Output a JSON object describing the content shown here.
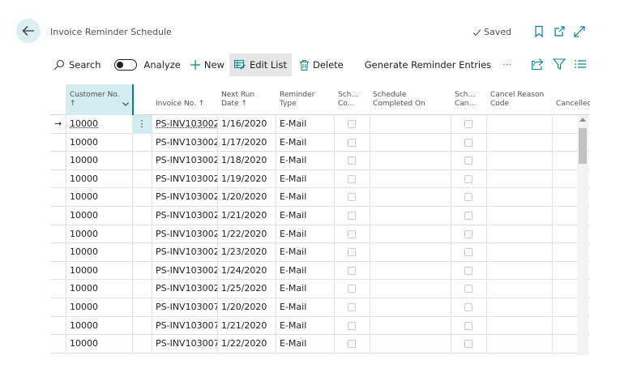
{
  "header": {
    "title": "Invoice Reminder Schedule",
    "saved_label": "Saved"
  },
  "toolbar": {
    "search": "Search",
    "analyze": "Analyze",
    "new": "New",
    "edit_list": "Edit List",
    "delete": "Delete",
    "generate": "Generate Reminder Entries",
    "more": "···"
  },
  "columns": [
    {
      "line1": "Customer No.",
      "line2": "↑"
    },
    {
      "line1": "",
      "line2": "Invoice No. ↑"
    },
    {
      "line1": "Next Run",
      "line2": "Date ↑"
    },
    {
      "line1": "Reminder",
      "line2": "Type"
    },
    {
      "line1": "Sch...",
      "line2": "Co..."
    },
    {
      "line1": "Schedule",
      "line2": "Completed On"
    },
    {
      "line1": "Sch...",
      "line2": "Can..."
    },
    {
      "line1": "Cancel Reason",
      "line2": "Code"
    },
    {
      "line1": "",
      "line2": "Cancelled"
    }
  ],
  "rows": [
    {
      "customer": "10000",
      "invoice": "PS-INV103002",
      "date": "1/16/2020",
      "type": "E-Mail"
    },
    {
      "customer": "10000",
      "invoice": "PS-INV103002",
      "date": "1/17/2020",
      "type": "E-Mail"
    },
    {
      "customer": "10000",
      "invoice": "PS-INV103002",
      "date": "1/18/2020",
      "type": "E-Mail"
    },
    {
      "customer": "10000",
      "invoice": "PS-INV103002",
      "date": "1/19/2020",
      "type": "E-Mail"
    },
    {
      "customer": "10000",
      "invoice": "PS-INV103002",
      "date": "1/20/2020",
      "type": "E-Mail"
    },
    {
      "customer": "10000",
      "invoice": "PS-INV103002",
      "date": "1/21/2020",
      "type": "E-Mail"
    },
    {
      "customer": "10000",
      "invoice": "PS-INV103002",
      "date": "1/22/2020",
      "type": "E-Mail"
    },
    {
      "customer": "10000",
      "invoice": "PS-INV103002",
      "date": "1/23/2020",
      "type": "E-Mail"
    },
    {
      "customer": "10000",
      "invoice": "PS-INV103002",
      "date": "1/24/2020",
      "type": "E-Mail"
    },
    {
      "customer": "10000",
      "invoice": "PS-INV103002",
      "date": "1/25/2020",
      "type": "E-Mail"
    },
    {
      "customer": "10000",
      "invoice": "PS-INV103007",
      "date": "1/20/2020",
      "type": "E-Mail"
    },
    {
      "customer": "10000",
      "invoice": "PS-INV103007",
      "date": "1/21/2020",
      "type": "E-Mail"
    },
    {
      "customer": "10000",
      "invoice": "PS-INV103007",
      "date": "1/22/2020",
      "type": "E-Mail"
    }
  ],
  "colors": {
    "accent": "#00838f",
    "selected_header": "#d3ecf0"
  }
}
